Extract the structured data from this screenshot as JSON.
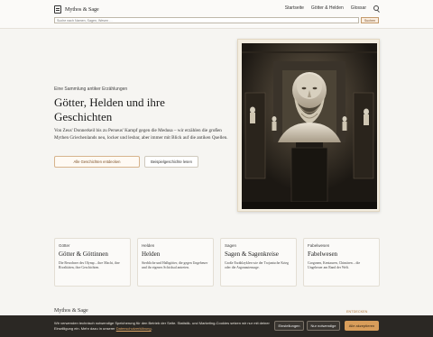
{
  "header": {
    "logo_text": "Mythos & Sage",
    "nav": [
      "Startseite",
      "Götter & Helden",
      "Glossar"
    ],
    "search_placeholder": "Suche nach Namen, Sagen, Wesen …",
    "search_button": "Suchen"
  },
  "hero": {
    "kicker": "Eine Sammlung antiker Erzählungen",
    "title": "Götter, Helden und ihre Geschichten",
    "text": "Von Zeus' Donnerkeil bis zu Perseus' Kampf gegen die Medusa – wir erzählen die großen Mythen Griechenlands neu, locker und lesbar, aber immer mit Blick auf die antiken Quellen.",
    "primary_button": "Alle Geschichten entdecken",
    "secondary_button": "Beispielgeschichte lesen"
  },
  "cards": [
    {
      "kicker": "Götter",
      "title": "Götter & Göttinnen",
      "text": "Die Bewohner des Olymp – ihre Macht, ihre Rivalitäten, ihre Geschichten."
    },
    {
      "kicker": "Helden",
      "title": "Helden",
      "text": "Sterbliche und Halbgötter, die gegen Ungeheuer und ihr eigenes Schicksal antreten."
    },
    {
      "kicker": "Sagen",
      "title": "Sagen & Sagenkreise",
      "text": "Große Erzählzyklen wie der Trojanische Krieg oder die Argonautensage."
    },
    {
      "kicker": "Fabelwesen",
      "title": "Fabelwesen",
      "text": "Gorgonen, Kentauren, Chimären – die Ungeheuer am Rand der Welt."
    }
  ],
  "below": {
    "label": "Mythos & Sage",
    "link": "ENTDECKEN"
  },
  "cookie": {
    "text": "Wir verwenden technisch notwendige Speicherung für den Betrieb der Seite. Statistik- und Marketing-Cookies setzen wir nur mit deiner Einwilligung ein. Mehr dazu in unserer",
    "link": "Datenschutzerklärung",
    "text_end": ".",
    "settings_button": "Einstellungen",
    "necessary_button": "Nur notwendige",
    "accept_button": "Alle akzeptieren"
  },
  "colors": {
    "accent": "#d89d5a",
    "background": "#f6f5f2",
    "cookie_bar": "#2b2824"
  }
}
